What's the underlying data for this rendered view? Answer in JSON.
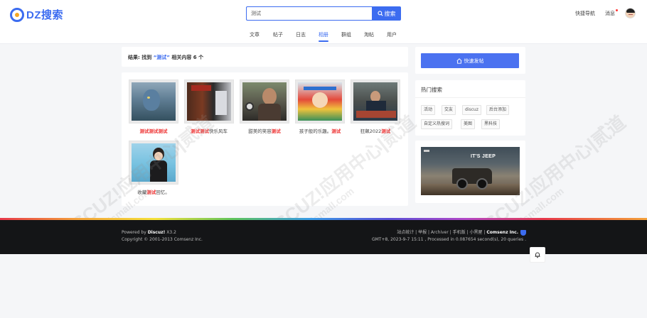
{
  "header": {
    "logo_text": "DZ搜索",
    "search_value": "测试",
    "search_button": "搜索",
    "nav_link": "快捷导航",
    "messages": "消息"
  },
  "tabs": [
    {
      "label": "文章",
      "active": false
    },
    {
      "label": "帖子",
      "active": false
    },
    {
      "label": "日志",
      "active": false
    },
    {
      "label": "相册",
      "active": true
    },
    {
      "label": "群组",
      "active": false
    },
    {
      "label": "淘帖",
      "active": false
    },
    {
      "label": "用户",
      "active": false
    }
  ],
  "result": {
    "prefix": "结果: 找到",
    "keyword": "“测试”",
    "suffix": "相关内容 6 个"
  },
  "albums": [
    {
      "pre": "",
      "hl": "测试测试测试",
      "post": ""
    },
    {
      "pre": "",
      "hl": "测试测试",
      "post": "快乐风车"
    },
    {
      "pre": "甜美的笑容",
      "hl": "测试",
      "post": ""
    },
    {
      "pre": "孩子般的乐趣。",
      "hl": "测试",
      "post": ""
    },
    {
      "pre": "狂飙2022",
      "hl": "测试",
      "post": ""
    },
    {
      "pre": "收藏",
      "hl": "测试",
      "post": "回忆。"
    }
  ],
  "sidebar": {
    "post_button": "快速发帖",
    "hot_title": "热门搜索",
    "tags": [
      "活动",
      "交友",
      "discuz",
      "后台添加",
      "自定义热搜词",
      "美图",
      "黑科技"
    ],
    "ad_title": "IT'S JEEP"
  },
  "footer": {
    "powered_prefix": "Powered by",
    "powered_name": "Discuz!",
    "version": "X3.2",
    "copyright": "Copyright © 2001-2013 Comsenz Inc.",
    "links": "站点统计 | 举报 | Archiver | 手机版 | 小黑屋 |",
    "company": "Comsenz Inc.",
    "stats": "GMT+8, 2023-9-7 15:11 , Processed in 0.087654 second(s), 20 queries ."
  },
  "watermark": {
    "line1": "DISCUZ!应用中心|贰道",
    "line2": "addon.dismall.com"
  },
  "colors": {
    "accent": "#3c6cf0",
    "highlight": "#e33333",
    "footer_bg": "#141517"
  }
}
